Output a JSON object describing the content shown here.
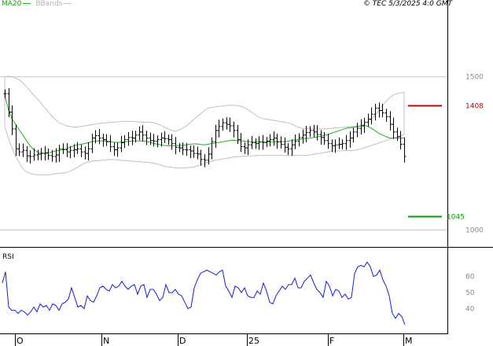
{
  "header": {
    "ma_label": "MA20",
    "bb_label": "BBands",
    "copyright": "© TEC 5/3/2025 4:0 GMT"
  },
  "colors": {
    "price": "#000000",
    "ma": "#1fae1f",
    "bbands": "#c0c0c0",
    "rsi": "#1a1ad6",
    "resistance": "#c00000",
    "support": "#00a000",
    "grid": "#c8c8c8"
  },
  "chart_data": [
    {
      "type": "line",
      "title": "",
      "x_labels": [
        "O",
        "N",
        "D",
        "25",
        "F",
        "M"
      ],
      "y_ticks": [
        1500,
        1000
      ],
      "ylim": [
        950,
        1720
      ],
      "levels": [
        {
          "label": "1408",
          "value": 1408,
          "role": "resistance"
        },
        {
          "label": "1045",
          "value": 1045,
          "role": "support"
        }
      ],
      "series": [
        {
          "role": "price",
          "values": [
            1445,
            1385,
            1330,
            1265,
            1255,
            1260,
            1242,
            1240,
            1245,
            1248,
            1250,
            1252,
            1243,
            1240,
            1245,
            1265,
            1262,
            1255,
            1260,
            1262,
            1265,
            1255,
            1250,
            1265,
            1300,
            1308,
            1300,
            1295,
            1288,
            1272,
            1262,
            1268,
            1285,
            1295,
            1302,
            1300,
            1310,
            1320,
            1310,
            1300,
            1292,
            1290,
            1295,
            1300,
            1298,
            1295,
            1282,
            1270,
            1268,
            1262,
            1262,
            1258,
            1250,
            1248,
            1230,
            1228,
            1248,
            1288,
            1325,
            1338,
            1350,
            1345,
            1340,
            1325,
            1295,
            1272,
            1268,
            1278,
            1285,
            1282,
            1288,
            1285,
            1290,
            1295,
            1300,
            1288,
            1280,
            1270,
            1265,
            1278,
            1290,
            1302,
            1310,
            1318,
            1325,
            1320,
            1312,
            1302,
            1292,
            1282,
            1275,
            1278,
            1280,
            1282,
            1292,
            1300,
            1320,
            1332,
            1340,
            1352,
            1362,
            1378,
            1398,
            1390,
            1382,
            1370,
            1345,
            1320,
            1305,
            1280,
            1240
          ]
        },
        {
          "role": "ma20",
          "values": [
            1440,
            1395,
            1363,
            1345,
            1327,
            1310,
            1292,
            1275,
            1262,
            1255,
            1252,
            1250,
            1251,
            1255,
            1258,
            1260,
            1262,
            1265,
            1270,
            1275,
            1278,
            1280,
            1282,
            1285,
            1288,
            1290,
            1291,
            1291,
            1290,
            1289,
            1287,
            1286,
            1287,
            1288,
            1289,
            1290,
            1291,
            1291,
            1290,
            1289,
            1287,
            1283,
            1280,
            1278,
            1276,
            1275,
            1275,
            1276,
            1276,
            1277,
            1278,
            1280,
            1281,
            1281,
            1279,
            1278,
            1280,
            1282,
            1284,
            1286,
            1288,
            1290,
            1292,
            1293,
            1292,
            1291,
            1290,
            1289,
            1288,
            1288,
            1287,
            1287,
            1288,
            1288,
            1288,
            1288,
            1288,
            1288,
            1290,
            1292,
            1294,
            1296,
            1298,
            1299,
            1300,
            1302,
            1304,
            1306,
            1309,
            1312,
            1316,
            1320,
            1324,
            1328,
            1332,
            1334,
            1335,
            1337,
            1340,
            1342,
            1338,
            1332,
            1324,
            1316,
            1310,
            1305,
            1300,
            1300,
            1300,
            1300,
            1300
          ]
        },
        {
          "role": "bb_upper",
          "values": [
            1500,
            1502,
            1500,
            1496,
            1490,
            1480,
            1468,
            1454,
            1440,
            1428,
            1414,
            1400,
            1386,
            1372,
            1360,
            1350,
            1345,
            1340,
            1338,
            1336,
            1336,
            1338,
            1340,
            1342,
            1344,
            1346,
            1348,
            1349,
            1350,
            1351,
            1352,
            1353,
            1354,
            1355,
            1355,
            1355,
            1354,
            1353,
            1352,
            1352,
            1352,
            1350,
            1346,
            1342,
            1336,
            1330,
            1325,
            1322,
            1326,
            1332,
            1340,
            1350,
            1360,
            1370,
            1380,
            1390,
            1398,
            1400,
            1402,
            1404,
            1405,
            1406,
            1407,
            1407,
            1406,
            1404,
            1400,
            1393,
            1385,
            1376,
            1368,
            1364,
            1362,
            1360,
            1358,
            1356,
            1354,
            1352,
            1350,
            1346,
            1340,
            1335,
            1332,
            1332,
            1332,
            1330,
            1330,
            1330,
            1330,
            1331,
            1332,
            1333,
            1334,
            1335,
            1336,
            1337,
            1338,
            1339,
            1340,
            1345,
            1352,
            1362,
            1374,
            1390,
            1406,
            1420,
            1432,
            1440,
            1445,
            1448,
            1450
          ]
        },
        {
          "role": "bb_lower",
          "values": [
            1340,
            1300,
            1270,
            1240,
            1220,
            1200,
            1190,
            1185,
            1182,
            1180,
            1180,
            1180,
            1180,
            1182,
            1184,
            1185,
            1186,
            1188,
            1192,
            1198,
            1205,
            1212,
            1218,
            1222,
            1225,
            1226,
            1227,
            1228,
            1229,
            1230,
            1230,
            1229,
            1228,
            1227,
            1226,
            1225,
            1224,
            1223,
            1222,
            1221,
            1220,
            1218,
            1216,
            1212,
            1208,
            1206,
            1205,
            1203,
            1202,
            1202,
            1203,
            1204,
            1206,
            1209,
            1213,
            1218,
            1222,
            1225,
            1228,
            1230,
            1232,
            1234,
            1236,
            1238,
            1239,
            1240,
            1241,
            1242,
            1242,
            1243,
            1243,
            1243,
            1243,
            1243,
            1243,
            1243,
            1243,
            1243,
            1243,
            1243,
            1243,
            1243,
            1243,
            1244,
            1245,
            1247,
            1249,
            1251,
            1253,
            1255,
            1257,
            1258,
            1258,
            1259,
            1259,
            1259,
            1260,
            1262,
            1265,
            1268,
            1272,
            1276,
            1280,
            1284,
            1288,
            1292,
            1296,
            1300,
            1304,
            1308,
            1312
          ]
        }
      ]
    },
    {
      "type": "line",
      "title": "RSI",
      "x_labels": [
        "O",
        "N",
        "D",
        "25",
        "F",
        "M"
      ],
      "y_ticks": [
        60,
        50,
        40
      ],
      "ylim": [
        28,
        77
      ],
      "series": [
        {
          "role": "rsi",
          "values": [
            56,
            63,
            41,
            39,
            39,
            37,
            39,
            38,
            36,
            38,
            41,
            38,
            43,
            41,
            42,
            39,
            43,
            42,
            39,
            43,
            44,
            46,
            53,
            47,
            41,
            42,
            40,
            48,
            45,
            44,
            48,
            53,
            54,
            52,
            51,
            55,
            53,
            54,
            57,
            54,
            52,
            54,
            55,
            49,
            54,
            55,
            47,
            52,
            52,
            49,
            45,
            47,
            55,
            50,
            50,
            52,
            49,
            48,
            44,
            40,
            41,
            53,
            58,
            62,
            63,
            64,
            63,
            62,
            61,
            63,
            64,
            54,
            51,
            47,
            54,
            53,
            50,
            53,
            48,
            47,
            47,
            51,
            49,
            56,
            51,
            44,
            43,
            48,
            51,
            54,
            52,
            55,
            55,
            59,
            53,
            53,
            57,
            59,
            61,
            56,
            52,
            50,
            47,
            57,
            54,
            48,
            52,
            51,
            47,
            49,
            46,
            47,
            62,
            66,
            67,
            66,
            69,
            66,
            60,
            61,
            64,
            58,
            54,
            48,
            37,
            34,
            37,
            35,
            30
          ]
        }
      ]
    }
  ]
}
